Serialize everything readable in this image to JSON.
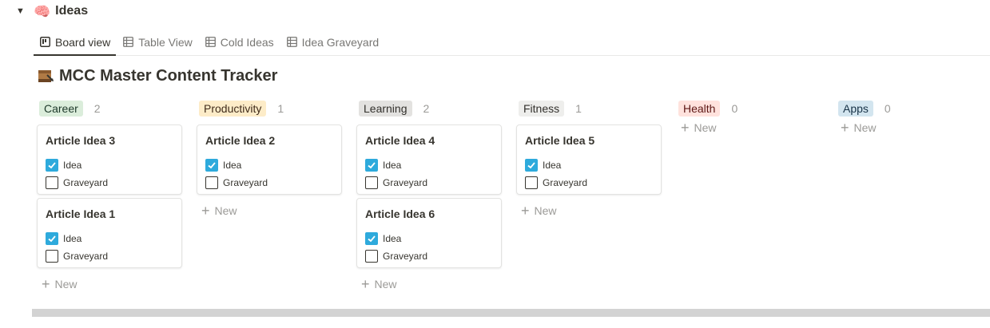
{
  "section": {
    "title": "Ideas",
    "icon": "🧠"
  },
  "tabs": [
    {
      "label": "Board view",
      "icon": "board-icon",
      "active": true
    },
    {
      "label": "Table View",
      "icon": "table-icon",
      "active": false
    },
    {
      "label": "Cold Ideas",
      "icon": "table-icon",
      "active": false
    },
    {
      "label": "Idea Graveyard",
      "icon": "table-icon",
      "active": false
    }
  ],
  "database": {
    "title": "MCC Master Content Tracker",
    "icon": "notebook-icon"
  },
  "columns": [
    {
      "name": "Career",
      "count": "2",
      "color": "#dbeddb",
      "text_color": "#1c3829",
      "cards": [
        {
          "title": "Article Idea 3",
          "idea_label": "Idea",
          "idea_checked": true,
          "graveyard_label": "Graveyard",
          "graveyard_checked": false
        },
        {
          "title": "Article Idea 1",
          "idea_label": "Idea",
          "idea_checked": true,
          "graveyard_label": "Graveyard",
          "graveyard_checked": false
        }
      ]
    },
    {
      "name": "Productivity",
      "count": "1",
      "color": "#fdecc8",
      "text_color": "#402c1b",
      "cards": [
        {
          "title": "Article Idea 2",
          "idea_label": "Idea",
          "idea_checked": true,
          "graveyard_label": "Graveyard",
          "graveyard_checked": false
        }
      ]
    },
    {
      "name": "Learning",
      "count": "2",
      "color": "#e3e2e0",
      "text_color": "#32302c",
      "cards": [
        {
          "title": "Article Idea 4",
          "idea_label": "Idea",
          "idea_checked": true,
          "graveyard_label": "Graveyard",
          "graveyard_checked": false
        },
        {
          "title": "Article Idea 6",
          "idea_label": "Idea",
          "idea_checked": true,
          "graveyard_label": "Graveyard",
          "graveyard_checked": false
        }
      ]
    },
    {
      "name": "Fitness",
      "count": "1",
      "color": "#eeeeec",
      "text_color": "#32302c",
      "cards": [
        {
          "title": "Article Idea 5",
          "idea_label": "Idea",
          "idea_checked": true,
          "graveyard_label": "Graveyard",
          "graveyard_checked": false
        }
      ]
    },
    {
      "name": "Health",
      "count": "0",
      "color": "#ffe2dd",
      "text_color": "#5d1715",
      "cards": []
    },
    {
      "name": "Apps",
      "count": "0",
      "color": "#d3e5ef",
      "text_color": "#183347",
      "cards": []
    }
  ],
  "new_label": "New",
  "colors": {
    "checkbox_checked": "#2eaadc",
    "text": "#37352f",
    "muted": "#9b9a97"
  }
}
